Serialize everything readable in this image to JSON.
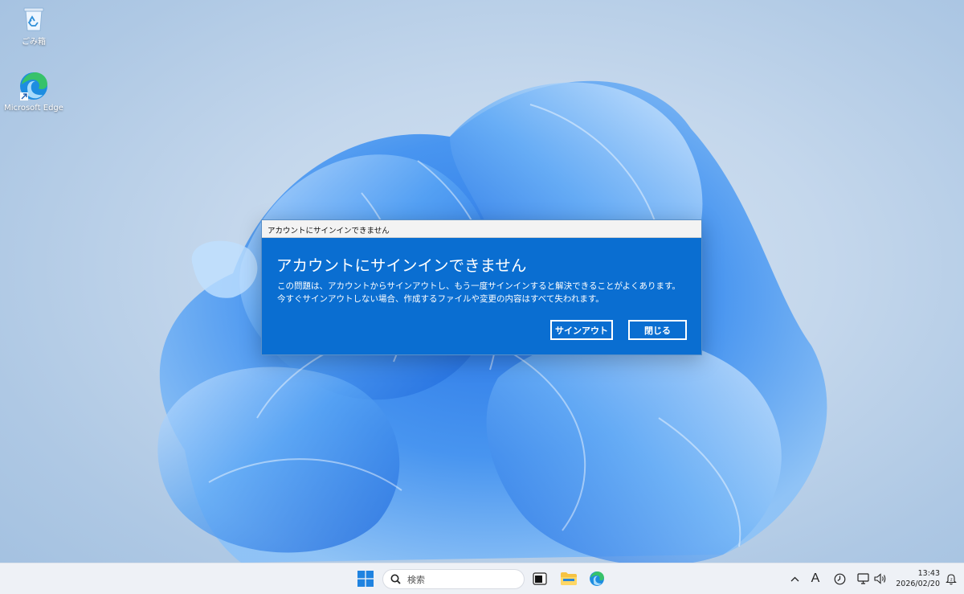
{
  "desktop": {
    "icons": [
      {
        "label": "ごみ箱",
        "icon": "recycle-bin-icon"
      },
      {
        "label": "Microsoft Edge",
        "icon": "edge-icon"
      }
    ]
  },
  "dialog": {
    "window_title": "アカウントにサインインできません",
    "heading": "アカウントにサインインできません",
    "message_line1": "この問題は、アカウントからサインアウトし、もう一度サインインすると解決できることがよくあります。",
    "message_line2": "今すぐサインアウトしない場合、作成するファイルや変更の内容はすべて失われます。",
    "signout_label": "サインアウト",
    "close_label": "閉じる",
    "accent": "#0a6ed1"
  },
  "taskbar": {
    "search_placeholder": "検索",
    "ime_indicator": "A",
    "time": "13:43",
    "date": "2026/02/20",
    "icons": [
      "windows-start-icon",
      "search-icon",
      "task-view-icon",
      "file-explorer-icon",
      "edge-icon",
      "chevron-up-icon",
      "clock-app-icon",
      "network-icon",
      "volume-icon",
      "notification-icon"
    ]
  }
}
